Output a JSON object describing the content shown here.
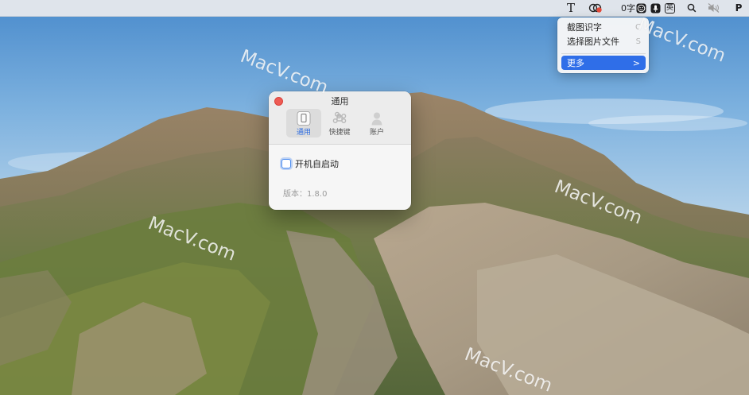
{
  "menubar": {
    "text_tool_icon": "T",
    "app_icon": "colorful-dots-icon",
    "word_count": "0字",
    "emoji_icon": "emoji-face-icon",
    "mic_icon": "microphone-icon",
    "input_method": "英",
    "search_icon": "magnifier-icon",
    "mute_icon": "muted-speaker-icon",
    "p_icon": "P"
  },
  "dropdown": {
    "items": [
      {
        "label": "截图识字",
        "shortcut": "C"
      },
      {
        "label": "选择图片文件",
        "shortcut": "S"
      },
      {
        "label": "更多",
        "shortcut": ">"
      }
    ]
  },
  "prefs_window": {
    "title": "通用",
    "tabs": [
      {
        "label": "通用",
        "icon": "phone-icon"
      },
      {
        "label": "快捷键",
        "icon": "command-key-icon"
      },
      {
        "label": "账户",
        "icon": "user-silhouette-icon"
      }
    ],
    "launch_at_login_label": "开机自启动",
    "launch_at_login_checked": false,
    "version_text": "版本：1.8.0"
  },
  "watermarks": [
    "MacV.com",
    "MacV.com",
    "MacV.com",
    "MacV.com",
    "MacV.com"
  ],
  "colors": {
    "accent": "#2f6ee8",
    "close_button": "#ee5b54"
  }
}
